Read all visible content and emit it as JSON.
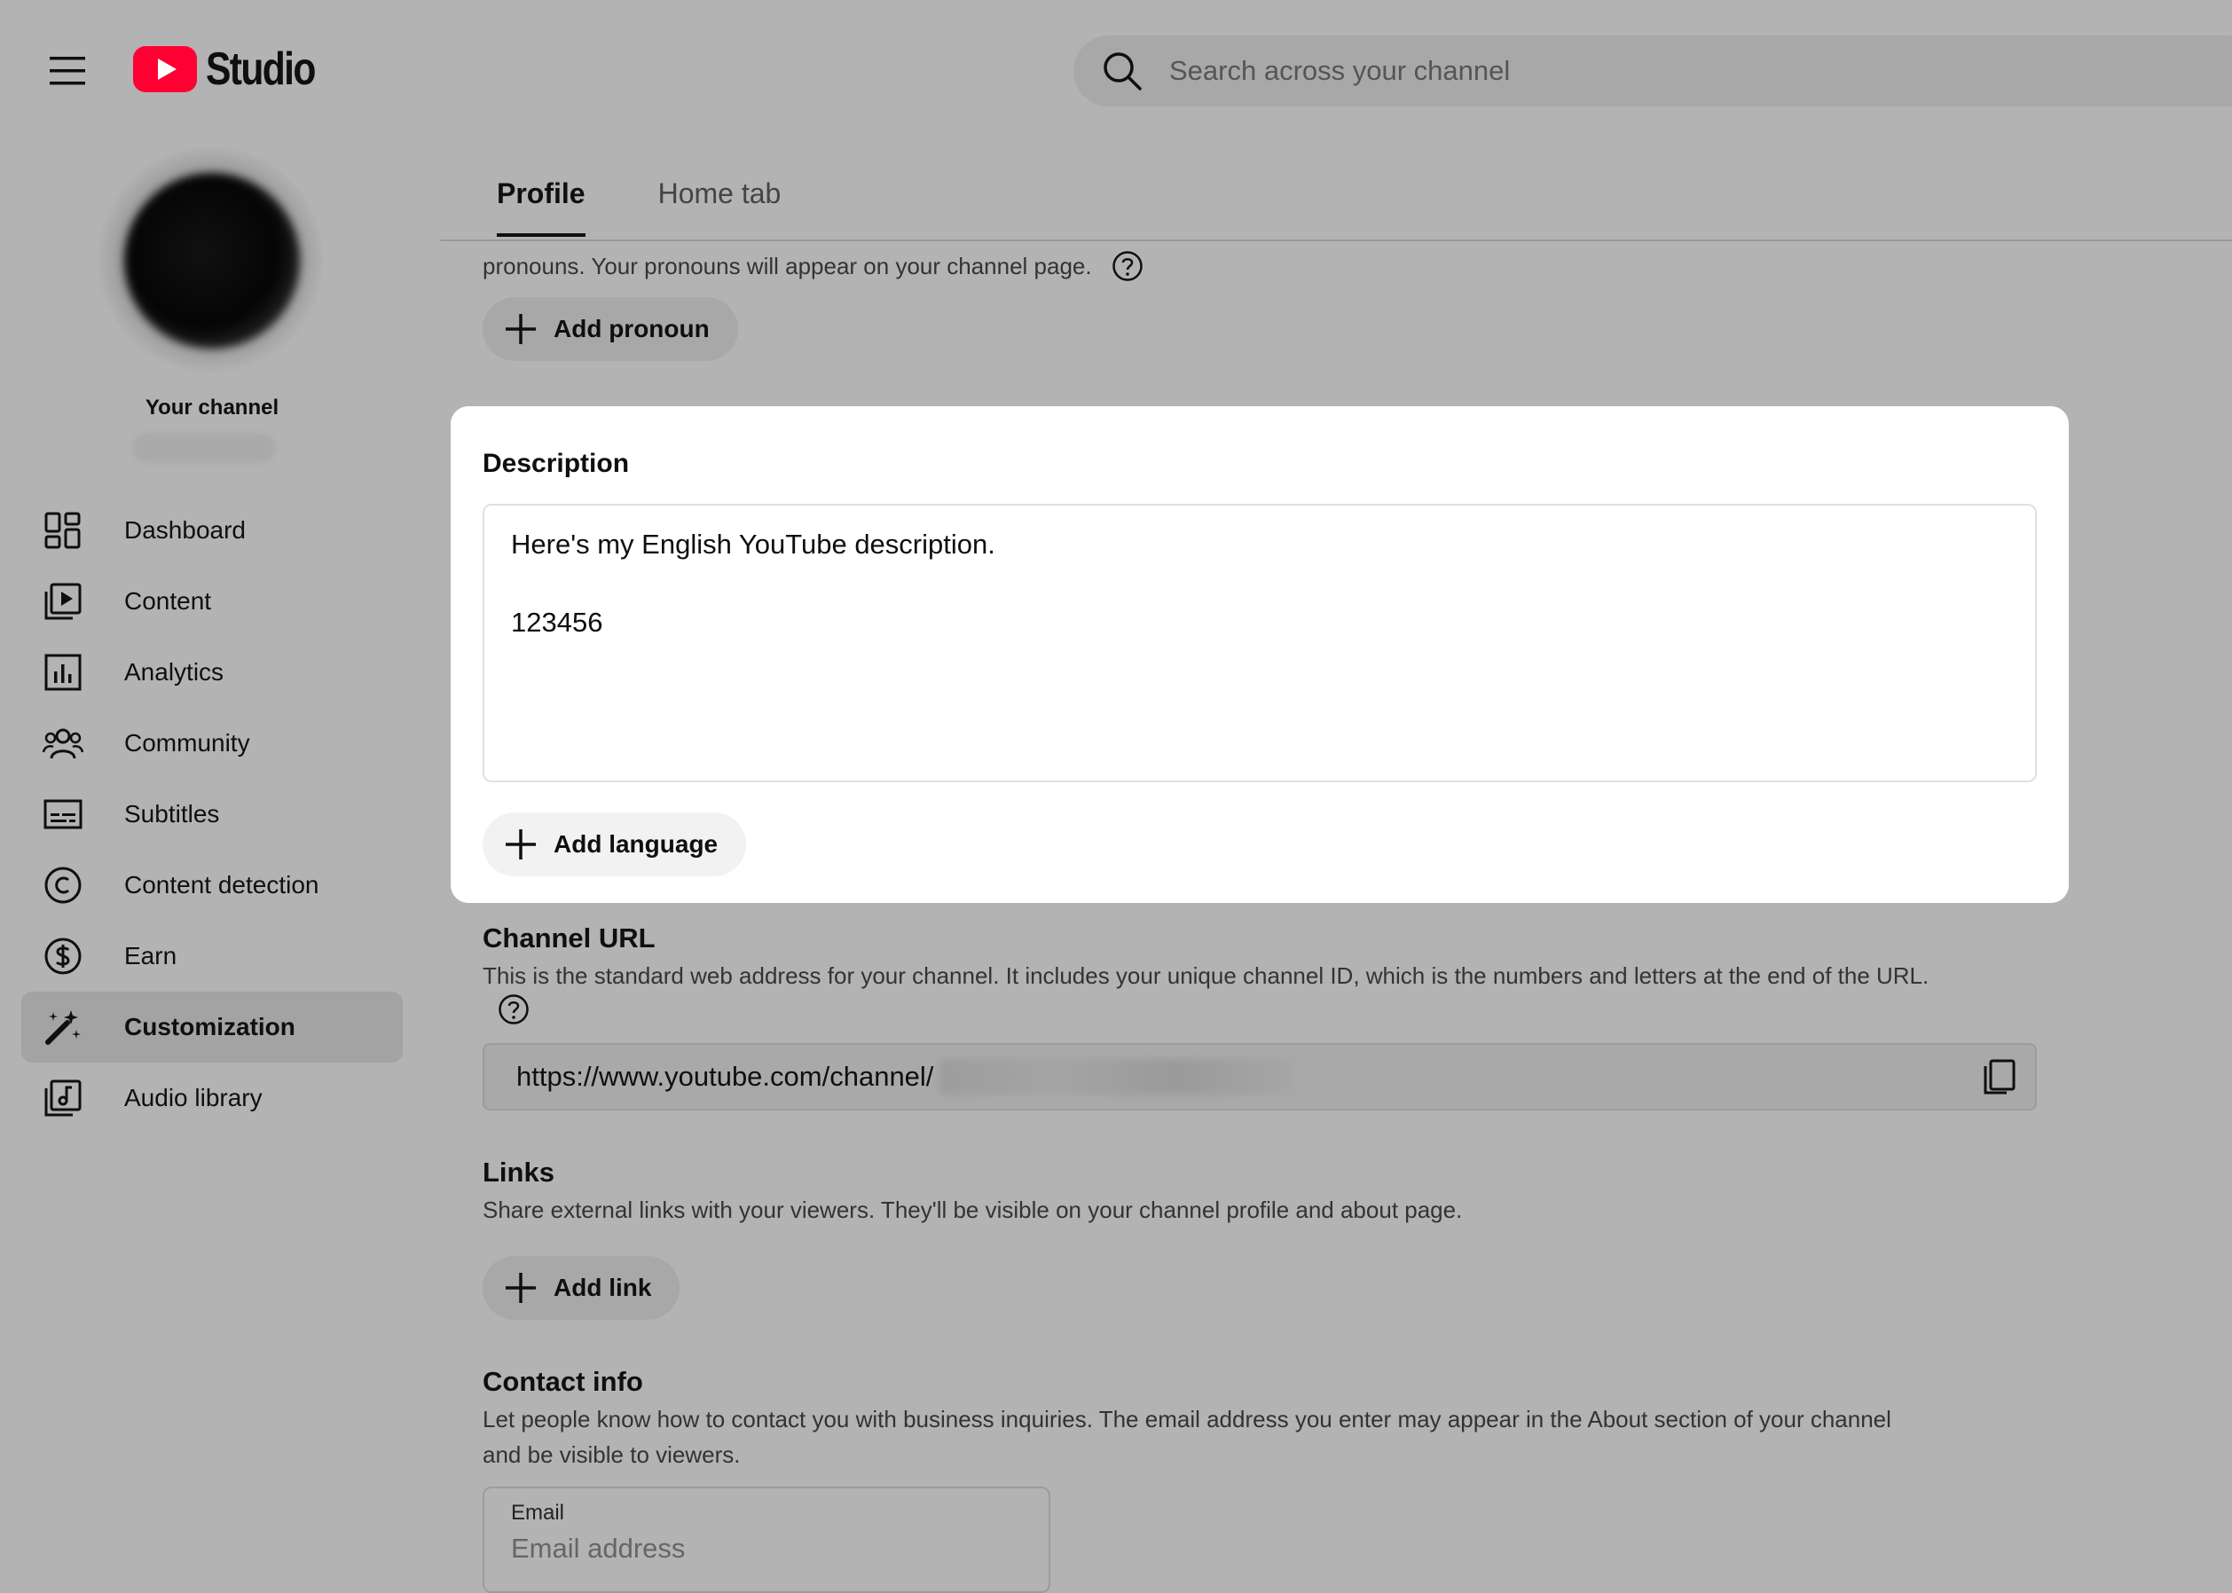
{
  "header": {
    "logo_text": "Studio",
    "search_placeholder": "Search across your channel"
  },
  "sidebar": {
    "channel_label": "Your channel",
    "items": [
      {
        "label": "Dashboard",
        "icon": "dashboard-icon",
        "active": false
      },
      {
        "label": "Content",
        "icon": "content-icon",
        "active": false
      },
      {
        "label": "Analytics",
        "icon": "analytics-icon",
        "active": false
      },
      {
        "label": "Community",
        "icon": "community-icon",
        "active": false
      },
      {
        "label": "Subtitles",
        "icon": "subtitles-icon",
        "active": false
      },
      {
        "label": "Content detection",
        "icon": "copyright-icon",
        "active": false
      },
      {
        "label": "Earn",
        "icon": "dollar-icon",
        "active": false
      },
      {
        "label": "Customization",
        "icon": "magic-wand-icon",
        "active": true
      },
      {
        "label": "Audio library",
        "icon": "audio-library-icon",
        "active": false
      }
    ]
  },
  "tabs": [
    {
      "label": "Profile",
      "active": true
    },
    {
      "label": "Home tab",
      "active": false
    }
  ],
  "pronouns": {
    "description": "pronouns. Your pronouns will appear on your channel page.",
    "add_label": "Add pronoun"
  },
  "description": {
    "title": "Description",
    "lines": [
      "Here's my English YouTube description.",
      "",
      "123456"
    ],
    "add_language_label": "Add language"
  },
  "channel_url": {
    "title": "Channel URL",
    "description": "This is the standard web address for your channel. It includes your unique channel ID, which is the numbers and letters at the end of the URL.",
    "url_prefix": "https://www.youtube.com/channel/"
  },
  "links": {
    "title": "Links",
    "description": "Share external links with your viewers. They'll be visible on your channel profile and about page.",
    "add_label": "Add link"
  },
  "contact": {
    "title": "Contact info",
    "description_line1": "Let people know how to contact you with business inquiries. The email address you enter may appear in the About section of your channel",
    "description_line2": "and be visible to viewers.",
    "email_label": "Email",
    "email_placeholder": "Email address"
  },
  "colors": {
    "logo_red": "#ff0033",
    "page_background": "#b3b3b3",
    "card_background": "#ffffff"
  }
}
